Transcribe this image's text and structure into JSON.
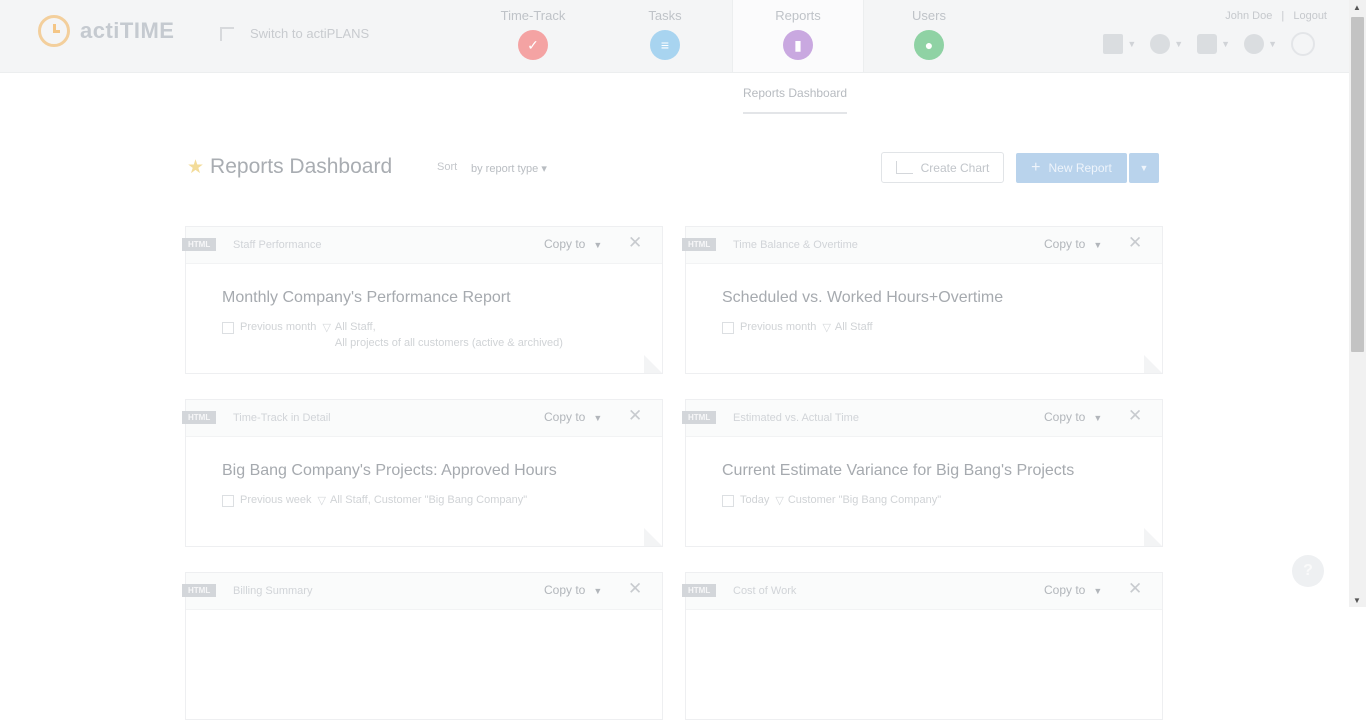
{
  "app": {
    "logo_text": "actiTIME",
    "switch_label": "Switch to actiPLANS"
  },
  "nav": [
    {
      "label": "Time-Track",
      "icon": "check-icon",
      "color": "#f4a3a3"
    },
    {
      "label": "Tasks",
      "icon": "list-icon",
      "color": "#a8d4f0"
    },
    {
      "label": "Reports",
      "icon": "chart-icon",
      "color": "#c9a8e0"
    },
    {
      "label": "Users",
      "icon": "user-icon",
      "color": "#8fd2a4"
    }
  ],
  "user": {
    "name": "John Doe",
    "separator": "|",
    "logout": "Logout"
  },
  "subtab": "Reports Dashboard",
  "page": {
    "title": "Reports Dashboard",
    "sort_label": "Sort",
    "sort_value": "by report type",
    "create_chart": "Create Chart",
    "new_report": "New Report"
  },
  "cards": [
    {
      "badge": "HTML",
      "type": "Staff Performance",
      "copy": "Copy to",
      "name": "Monthly Company's Performance Report",
      "period": "Previous month",
      "filter": "All Staff,",
      "filter2": "All projects of all customers (active & archived)"
    },
    {
      "badge": "HTML",
      "type": "Time Balance & Overtime",
      "copy": "Copy to",
      "name": "Scheduled vs. Worked Hours+Overtime",
      "period": "Previous month",
      "filter": "All Staff",
      "filter2": ""
    },
    {
      "badge": "HTML",
      "type": "Time-Track in Detail",
      "copy": "Copy to",
      "name": "Big Bang Company's Projects: Approved Hours",
      "period": "Previous week",
      "filter": "All Staff, Customer \"Big Bang Company\"",
      "filter2": ""
    },
    {
      "badge": "HTML",
      "type": "Estimated vs. Actual Time",
      "copy": "Copy to",
      "name": "Current Estimate Variance for Big Bang's Projects",
      "period": "Today",
      "filter": "Customer \"Big Bang Company\"",
      "filter2": ""
    },
    {
      "badge": "HTML",
      "type": "Billing Summary",
      "copy": "Copy to",
      "name": "",
      "period": "",
      "filter": "",
      "filter2": ""
    },
    {
      "badge": "HTML",
      "type": "Cost of Work",
      "copy": "Copy to",
      "name": "",
      "period": "",
      "filter": "",
      "filter2": ""
    }
  ],
  "help": "?"
}
